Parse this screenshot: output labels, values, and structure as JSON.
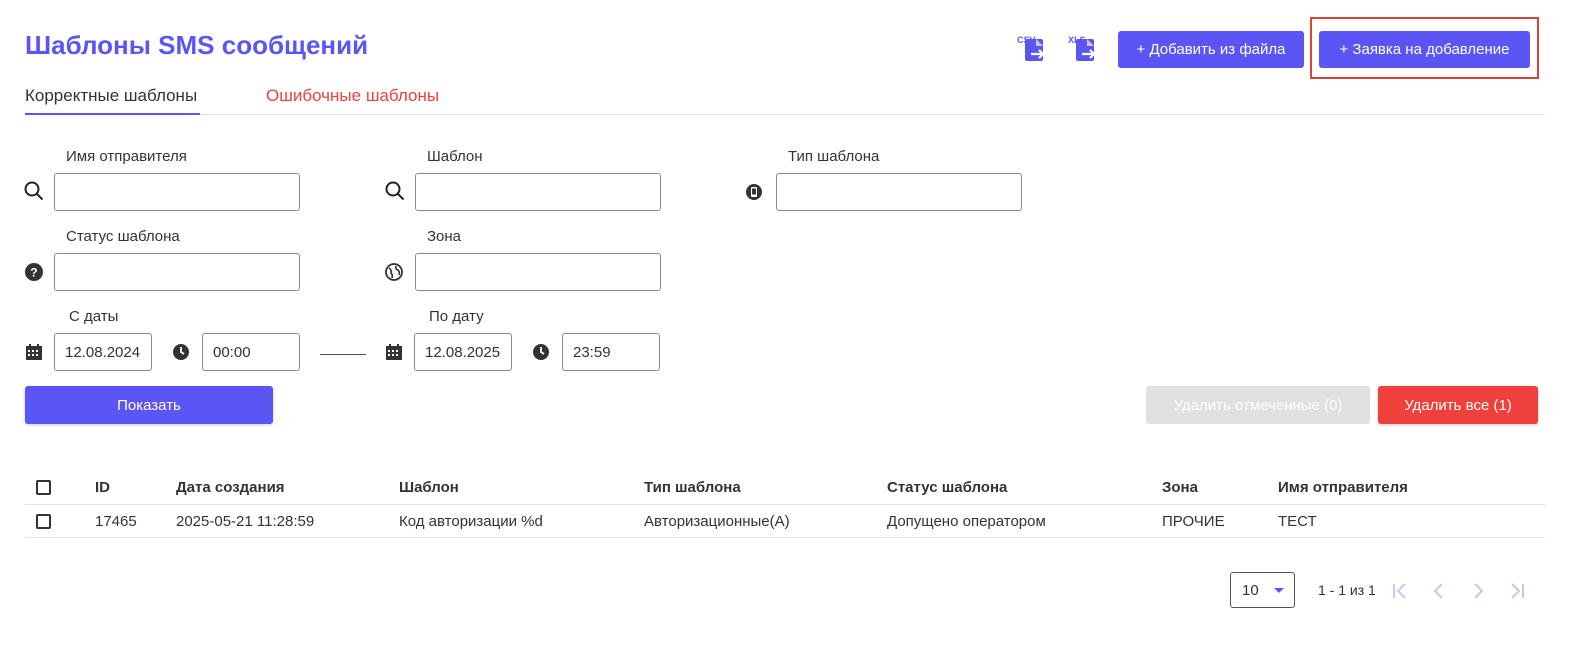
{
  "page": {
    "title": "Шаблоны SMS сообщений"
  },
  "header": {
    "csv_label": "CSV",
    "xls_label": "XLS",
    "add_from_file": "+ Добавить из файла",
    "add_request": "+ Заявка на добавление"
  },
  "tabs": [
    {
      "label": "Корректные шаблоны",
      "active": true
    },
    {
      "label": "Ошибочные шаблоны",
      "active": false
    }
  ],
  "filters": {
    "sender_name": {
      "label": "Имя отправителя",
      "value": ""
    },
    "template": {
      "label": "Шаблон",
      "value": ""
    },
    "template_type": {
      "label": "Тип шаблона",
      "value": ""
    },
    "template_status": {
      "label": "Статус шаблона",
      "value": ""
    },
    "zone": {
      "label": "Зона",
      "value": ""
    },
    "date_from": {
      "label": "С даты",
      "date": "12.08.2024",
      "time": "00:00"
    },
    "date_to": {
      "label": "По дату",
      "date": "12.08.2025",
      "time": "23:59"
    }
  },
  "actions": {
    "show": "Показать",
    "delete_selected": "Удалить отмеченные (0)",
    "delete_all": "Удалить все (1)"
  },
  "table": {
    "headers": [
      "ID",
      "Дата создания",
      "Шаблон",
      "Тип шаблона",
      "Статус шаблона",
      "Зона",
      "Имя отправителя"
    ],
    "rows": [
      [
        "17465",
        "2025-05-21 11:28:59",
        "Код авторизации %d",
        "Авторизационные(А)",
        "Допущено оператором",
        "ПРОЧИЕ",
        "ТЕСТ"
      ]
    ]
  },
  "pagination": {
    "page_size": "10",
    "range": "1 - 1 из 1"
  },
  "colors": {
    "accent": "#5b55f5",
    "danger": "#f0403c",
    "disabled": "#e0e0e0",
    "highlight": "#d9413a"
  }
}
